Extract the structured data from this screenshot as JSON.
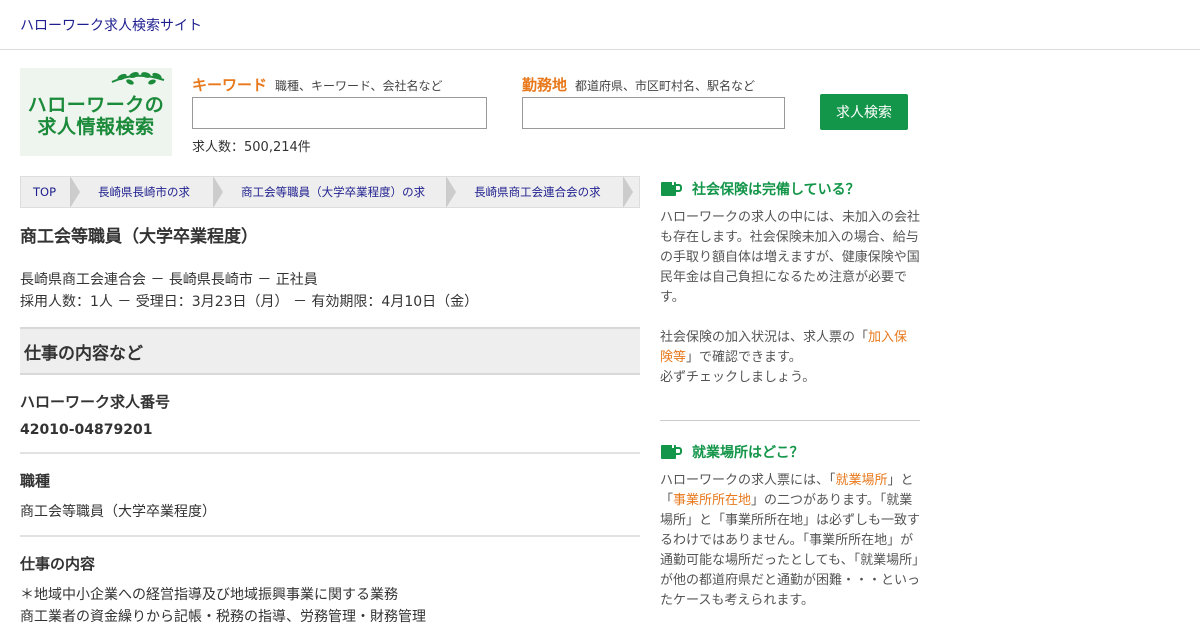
{
  "header": {
    "site_name": "ハローワーク求人検索サイト"
  },
  "logo": {
    "line1": "ハローワークの",
    "line2": "求人情報検索"
  },
  "search": {
    "keyword_label": "キーワード",
    "keyword_hint": "職種、キーワード、会社名など",
    "keyword_value": "",
    "location_label": "勤務地",
    "location_hint": "都道府県、市区町村名、駅名など",
    "location_value": "",
    "count_text": "求人数：500,214件",
    "button_label": "求人検索"
  },
  "breadcrumb": [
    "TOP",
    "長崎県長崎市の求人",
    "商工会等職員（大学卒業程度）の求人",
    "長崎県商工会連合会の求人"
  ],
  "job": {
    "title": "商工会等職員（大学卒業程度）",
    "meta_line1": "長崎県商工会連合会 － 長崎県長崎市 － 正社員",
    "meta_line2": "採用人数：1人 － 受理日：3月23日（月） － 有効期限：4月10日（金）"
  },
  "section": {
    "title": "仕事の内容など"
  },
  "items": {
    "number_label": "ハローワーク求人番号",
    "number_value": "42010-04879201",
    "occupation_label": "職種",
    "occupation_value": "商工会等職員（大学卒業程度）",
    "content_label": "仕事の内容",
    "content_line1": "＊地域中小企業への経営指導及び地域振興事業に関する業務",
    "content_line2": "商工業者の資金繰りから記帳・税務の指導、労務管理・財務管理"
  },
  "sidebar": {
    "block1": {
      "title": "社会保険は完備している？",
      "p1": "ハローワークの求人の中には、未加入の会社も存在します。社会保険未加入の場合、給与の手取り額自体は増えますが、健康保険や国民年金は自己負担になるため注意が必要です。",
      "p2_a": "社会保険の加入状況は、求人票の「",
      "p2_link": "加入保険等",
      "p2_b": "」で確認できます。",
      "p2_c": "必ずチェックしましょう。"
    },
    "block2": {
      "title": "就業場所はどこ？",
      "a": "ハローワークの求人票には、「",
      "link1": "就業場所",
      "b": "」と「",
      "link2": "事業所所在地",
      "c": "」の二つがあります。「就業場所」と「事業所所在地」は必ずしも一致するわけではありません。「事業所所在地」が通勤可能な場所だったとしても、「就業場所」が他の都道府県だと通勤が困難・・・といったケースも考えられます。"
    }
  },
  "colors": {
    "accent_green": "#14964a",
    "accent_orange": "#e8791c",
    "link_navy": "#1f1f8f"
  }
}
